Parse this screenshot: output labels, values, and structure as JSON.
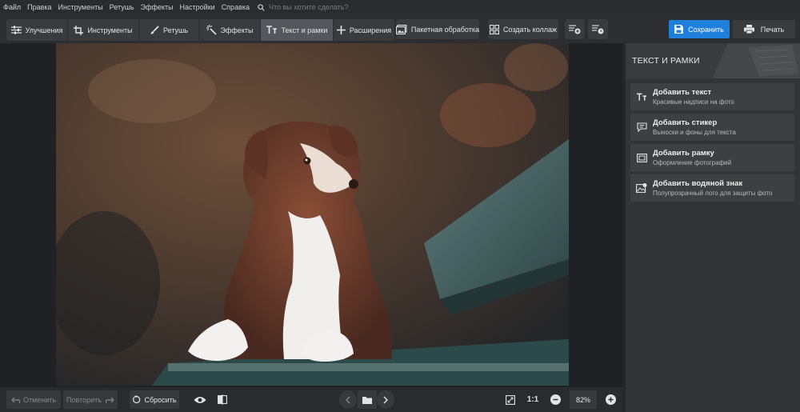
{
  "menu": [
    "Файл",
    "Правка",
    "Инструменты",
    "Ретушь",
    "Эффекты",
    "Настройки",
    "Справка"
  ],
  "search_placeholder": "Что вы хотите сделать?",
  "tabs": [
    {
      "label": "Улучшения",
      "icon": "sliders-icon"
    },
    {
      "label": "Инструменты",
      "icon": "crop-icon"
    },
    {
      "label": "Ретушь",
      "icon": "brush-icon"
    },
    {
      "label": "Эффекты",
      "icon": "magic-wand-icon"
    },
    {
      "label": "Текст и рамки",
      "icon": "text-icon",
      "active": true
    },
    {
      "label": "Расширения",
      "icon": "plus-icon"
    }
  ],
  "toolbar": {
    "batch_label": "Пакетная обработка",
    "collage_label": "Создать коллаж",
    "save_label": "Сохранить",
    "print_label": "Печать"
  },
  "sidebar": {
    "title": "ТЕКСТ И РАМКИ",
    "items": [
      {
        "title": "Добавить текст",
        "subtitle": "Красивые надписи на фото",
        "icon": "text-icon"
      },
      {
        "title": "Добавить стикер",
        "subtitle": "Выноски и фоны для текста",
        "icon": "speech-bubble-icon"
      },
      {
        "title": "Добавить рамку",
        "subtitle": "Оформление фотографий",
        "icon": "frame-icon"
      },
      {
        "title": "Добавить водяной знак",
        "subtitle": "Полупрозрачный лого для защиты фото",
        "icon": "watermark-icon"
      }
    ]
  },
  "bottom": {
    "undo_label": "Отменить",
    "redo_label": "Повторить",
    "reset_label": "Сбросить",
    "ratio_label": "1:1",
    "zoom": "82%"
  },
  "colors": {
    "accent": "#1f7fdc",
    "background": "#2b2c2f",
    "panel": "#333438"
  }
}
